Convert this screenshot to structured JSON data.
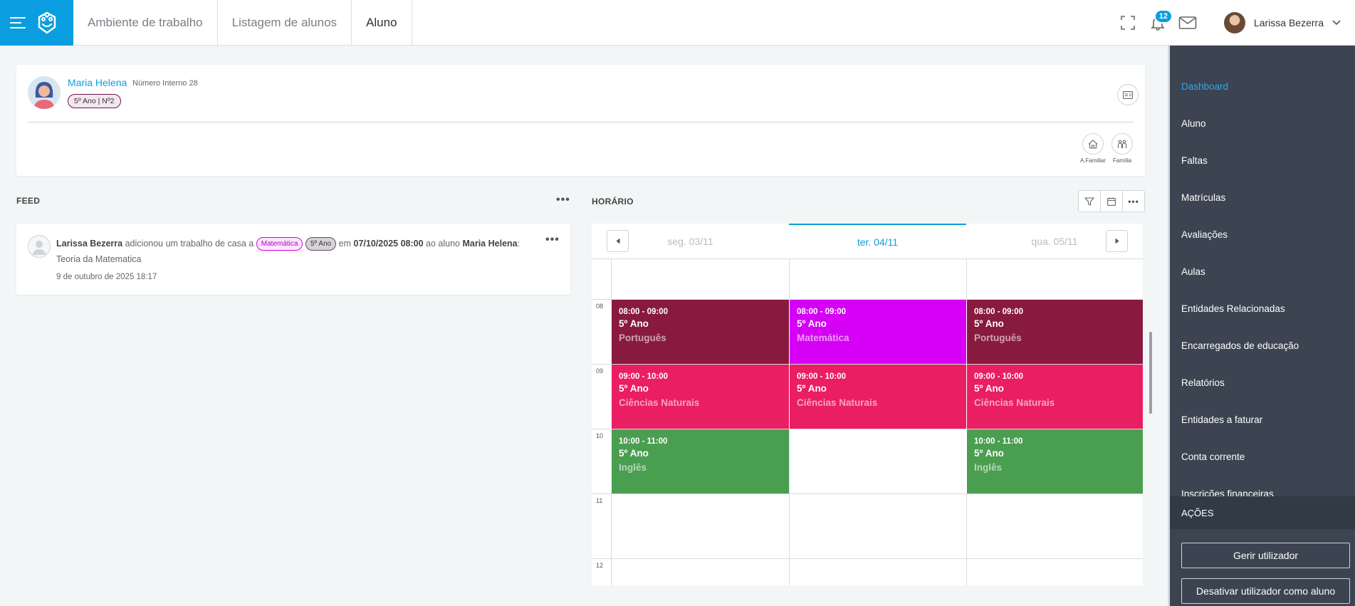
{
  "header": {
    "breadcrumbs": [
      "Ambiente de trabalho",
      "Listagem de alunos",
      "Aluno"
    ],
    "notifications_count": "12",
    "user_name": "Larissa Bezerra",
    "accent": "#0a9ee0"
  },
  "sidebar": {
    "items": [
      {
        "label": "Dashboard",
        "active": true
      },
      {
        "label": "Aluno"
      },
      {
        "label": "Faltas"
      },
      {
        "label": "Matrículas"
      },
      {
        "label": "Avaliações"
      },
      {
        "label": "Aulas"
      },
      {
        "label": "Entidades Relacionadas"
      },
      {
        "label": "Encarregados de educação"
      },
      {
        "label": "Relatórios"
      },
      {
        "label": "Entidades a faturar"
      },
      {
        "label": "Conta corrente"
      },
      {
        "label": "Inscrições financeiras"
      }
    ],
    "actions_title": "AÇÕES",
    "buttons": [
      "Gerir utilizador",
      "Desativar utilizador como aluno"
    ]
  },
  "student": {
    "name": "Maria Helena",
    "internal_number": "Número Interno 28",
    "class_badge": "5º Ano | Nº2",
    "actions": [
      "A.Familiar",
      "Família"
    ]
  },
  "feed": {
    "title": "FEED",
    "items": [
      {
        "author": "Larissa Bezerra",
        "action": "adicionou um trabalho de casa a",
        "subject_tag": "Matemática",
        "class_tag": "5º Ano",
        "on": "em",
        "datetime": "07/10/2025 08:00",
        "to_student": "ao aluno",
        "student": "Maria Helena",
        "colon": ":",
        "title": "Teoria da Matematica",
        "timestamp": "9 de outubro de 2025 18:17"
      }
    ]
  },
  "schedule": {
    "title": "HORÁRIO",
    "days": [
      "seg. 03/11",
      "ter. 04/11",
      "qua. 05/11"
    ],
    "active_day": 1,
    "hours": [
      "08",
      "09",
      "10",
      "11",
      "12"
    ],
    "lessons": [
      {
        "day": 0,
        "start": 8,
        "time": "08:00 - 09:00",
        "class": "5º Ano",
        "subject": "Português",
        "color": "#881a3f"
      },
      {
        "day": 1,
        "start": 8,
        "time": "08:00 - 09:00",
        "class": "5º Ano",
        "subject": "Matemática",
        "color": "#d500f5"
      },
      {
        "day": 2,
        "start": 8,
        "time": "08:00 - 09:00",
        "class": "5º Ano",
        "subject": "Português",
        "color": "#881a3f"
      },
      {
        "day": 0,
        "start": 9,
        "time": "09:00 - 10:00",
        "class": "5º Ano",
        "subject": "Ciências Naturais",
        "color": "#e91e63"
      },
      {
        "day": 1,
        "start": 9,
        "time": "09:00 - 10:00",
        "class": "5º Ano",
        "subject": "Ciências Naturais",
        "color": "#e91e63"
      },
      {
        "day": 2,
        "start": 9,
        "time": "09:00 - 10:00",
        "class": "5º Ano",
        "subject": "Ciências Naturais",
        "color": "#e91e63"
      },
      {
        "day": 0,
        "start": 10,
        "time": "10:00 - 11:00",
        "class": "5º Ano",
        "subject": "Inglês",
        "color": "#4a9e50"
      },
      {
        "day": 2,
        "start": 10,
        "time": "10:00 - 11:00",
        "class": "5º Ano",
        "subject": "Inglês",
        "color": "#4a9e50"
      }
    ]
  }
}
